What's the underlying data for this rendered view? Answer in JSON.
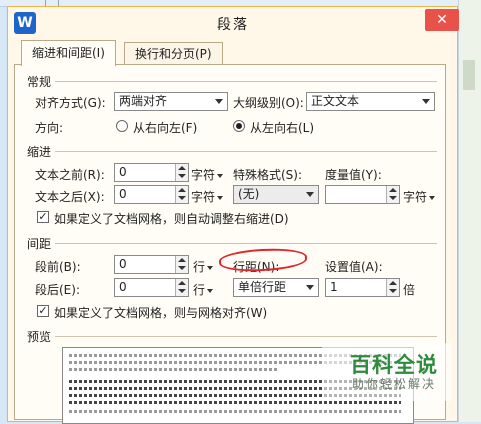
{
  "window": {
    "title": "段落",
    "app_icon": "W"
  },
  "tabs": [
    {
      "label": "缩进和间距(I)",
      "active": true
    },
    {
      "label": "换行和分页(P)",
      "active": false
    }
  ],
  "general": {
    "section": "常规",
    "alignment_label": "对齐方式(G):",
    "alignment_value": "两端对齐",
    "outline_label": "大纲级别(O):",
    "outline_value": "正文文本",
    "direction_label": "方向:",
    "rtl_label": "从右向左(F)",
    "ltr_label": "从左向右(L)",
    "ltr_selected": true
  },
  "indent": {
    "section": "缩进",
    "before_label": "文本之前(R):",
    "before_value": "0",
    "before_unit": "字符",
    "after_label": "文本之后(X):",
    "after_value": "0",
    "after_unit": "字符",
    "special_label": "特殊格式(S):",
    "special_value": "(无)",
    "measure_label": "度量值(Y):",
    "measure_value": "",
    "measure_unit": "字符",
    "auto_adjust_label": "如果定义了文档网格，则自动调整右缩进(D)",
    "auto_adjust_checked": true
  },
  "spacing": {
    "section": "间距",
    "before_label": "段前(B):",
    "before_value": "0",
    "before_unit": "行",
    "after_label": "段后(E):",
    "after_value": "0",
    "after_unit": "行",
    "line_label": "行距(N):",
    "line_value": "单倍行距",
    "setting_label": "设置值(A):",
    "setting_value": "1",
    "setting_unit": "倍",
    "snap_grid_label": "如果定义了文档网格，则与网格对齐(W)",
    "snap_grid_checked": true
  },
  "preview": {
    "section": "预览"
  },
  "watermark": {
    "title": "百科全说",
    "subtitle": "助你轻松解决"
  },
  "colors": {
    "accent": "#f0b34b",
    "close": "#e9514b",
    "annotation": "#e0262c",
    "watermark": "#2e8b3e"
  }
}
